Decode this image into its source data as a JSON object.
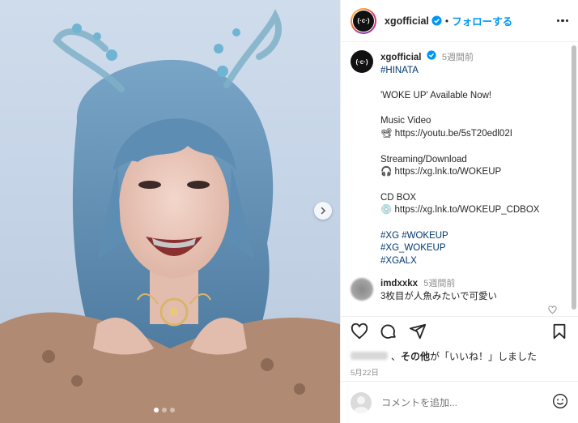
{
  "header": {
    "avatar_text": "(·c·)",
    "username": "xgofficial",
    "separator": "•",
    "follow_label": "フォローする"
  },
  "caption": {
    "username": "xgofficial",
    "time": "5週間前",
    "lines": [
      "#HINATA",
      "",
      "'WOKE UP' Available Now!",
      "",
      "Music Video",
      "📽 https://youtu.be/5sT20edl02I",
      "",
      "Streaming/Download",
      "🎧 https://xg.lnk.to/WOKEUP",
      "",
      "CD BOX",
      "💿 https://xg.lnk.to/WOKEUP_CDBOX",
      "",
      "#XG #WOKEUP",
      "#XG_WOKEUP",
      "#XGALX"
    ]
  },
  "comment": {
    "username": "imdxxkx",
    "time": "5週間前",
    "text": "3枚目が人魚みたいで可愛い"
  },
  "likes": {
    "text": "、その他が「いいね！」しました",
    "bold": "その他"
  },
  "date": "5月22日",
  "add_comment": {
    "placeholder": "コメントを追加..."
  },
  "carousel": {
    "total": 3,
    "current": 1
  },
  "icons": {
    "like": "heart-icon",
    "comment": "comment-icon",
    "share": "paper-plane-icon",
    "save": "bookmark-icon",
    "emoji": "smiley-icon",
    "verified": "verified-badge-icon",
    "next": "chevron-right-icon",
    "more": "more-horizontal-icon"
  },
  "colors": {
    "follow": "#0095f6",
    "verified": "#0095f6",
    "hashtag": "#00376b",
    "muted": "#8e8e8e"
  }
}
